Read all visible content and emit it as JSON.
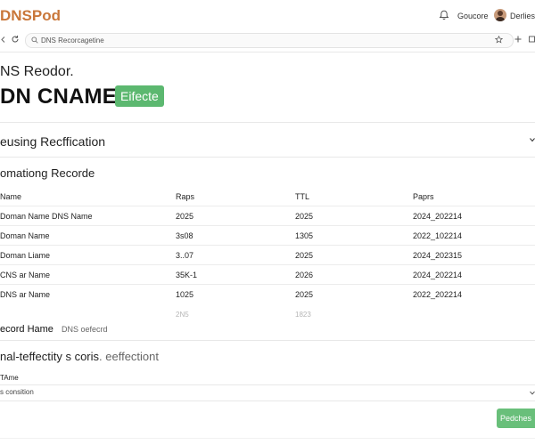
{
  "app": {
    "brand": "DNSPod"
  },
  "header": {
    "account_label": "Goucore",
    "user_name": "Derlies"
  },
  "browser": {
    "url": "DNS Recorcagetine"
  },
  "page": {
    "subtitle": "NS Reodor.",
    "title": "DN CNAME",
    "status_badge": "Eifecte"
  },
  "sections": {
    "verification": "eusing Recffication",
    "records": "omationg Recorde"
  },
  "table": {
    "headers": [
      "Name",
      "Raps",
      "TTL",
      "Paprs"
    ],
    "rows": [
      [
        "Doman Name  DNS Name",
        "2025",
        "2025",
        "2024_202214"
      ],
      [
        "Doman Name",
        "3s08",
        "1305",
        "2022_102214"
      ],
      [
        "Doman Liame",
        "3..07",
        "2025",
        "2024_202315"
      ],
      [
        "CNS ar Name",
        "35K-1",
        "2026",
        "2024_202214"
      ],
      [
        "DNS ar Name",
        "1025",
        "2025",
        "2022_202214"
      ]
    ],
    "faint_row": [
      "2N5",
      "1823"
    ]
  },
  "record": {
    "label": "ecord Hame",
    "value": "DNS oefecrd"
  },
  "effectivity": {
    "heading": "nal-teffectity s coris",
    "suffix": ". eeffectiont"
  },
  "form": {
    "name_label": "TAme",
    "select_value": "s consition",
    "submit_label": "Pedches"
  },
  "icons": {
    "bell": "bell-icon",
    "back": "back-arrow-icon",
    "reload": "reload-icon",
    "search": "search-icon",
    "star": "star-icon",
    "plus": "plus-icon",
    "window": "window-icon",
    "chevron": "chevron-down-icon"
  },
  "colors": {
    "brand": "#c9773a",
    "badge": "#5cb870",
    "button": "#69bf7a"
  }
}
